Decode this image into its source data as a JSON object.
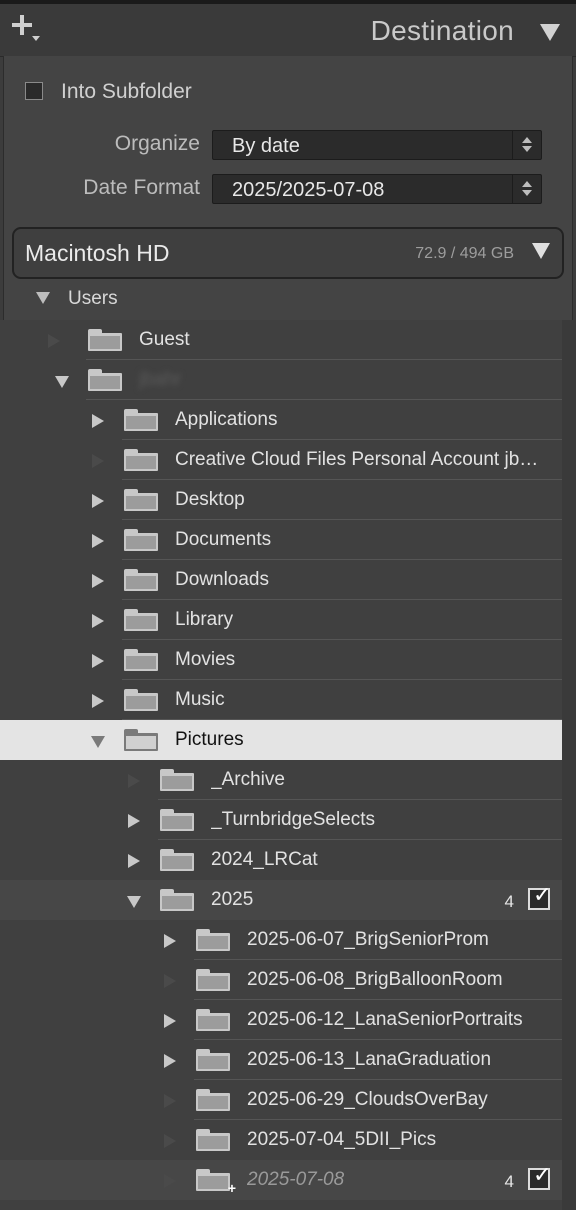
{
  "header": {
    "title": "Destination",
    "add_icon": "plus-icon",
    "collapse_icon": "triangle-down-icon"
  },
  "options": {
    "into_subfolder_label": "Into Subfolder",
    "into_subfolder_checked": false,
    "organize_label": "Organize",
    "organize_value": "By date",
    "date_format_label": "Date Format",
    "date_format_value": "2025/2025-07-08"
  },
  "volume": {
    "name": "Macintosh HD",
    "size": "72.9 / 494 GB"
  },
  "users_label": "Users",
  "tree": [
    {
      "name": "Guest"
    },
    {
      "name": "jbahr"
    },
    {
      "name": "Applications"
    },
    {
      "name": "Creative Cloud Files Personal Account jbah…"
    },
    {
      "name": "Desktop"
    },
    {
      "name": "Documents"
    },
    {
      "name": "Downloads"
    },
    {
      "name": "Library"
    },
    {
      "name": "Movies"
    },
    {
      "name": "Music"
    },
    {
      "name": "Pictures"
    },
    {
      "name": "_Archive"
    },
    {
      "name": "_TurnbridgeSelects"
    },
    {
      "name": "2024_LRCat"
    },
    {
      "name": "2025",
      "count": "4"
    },
    {
      "name": "2025-06-07_BrigSeniorProm"
    },
    {
      "name": "2025-06-08_BrigBalloonRoom"
    },
    {
      "name": "2025-06-12_LanaSeniorPortraits"
    },
    {
      "name": "2025-06-13_LanaGraduation"
    },
    {
      "name": "2025-06-29_CloudsOverBay"
    },
    {
      "name": "2025-07-04_5DII_Pics"
    },
    {
      "name": "2025-07-08",
      "count": "4"
    }
  ],
  "colors": {
    "panel_bg": "#404040",
    "selected_row": "#e4e4e4",
    "text": "#e2e2e2"
  }
}
